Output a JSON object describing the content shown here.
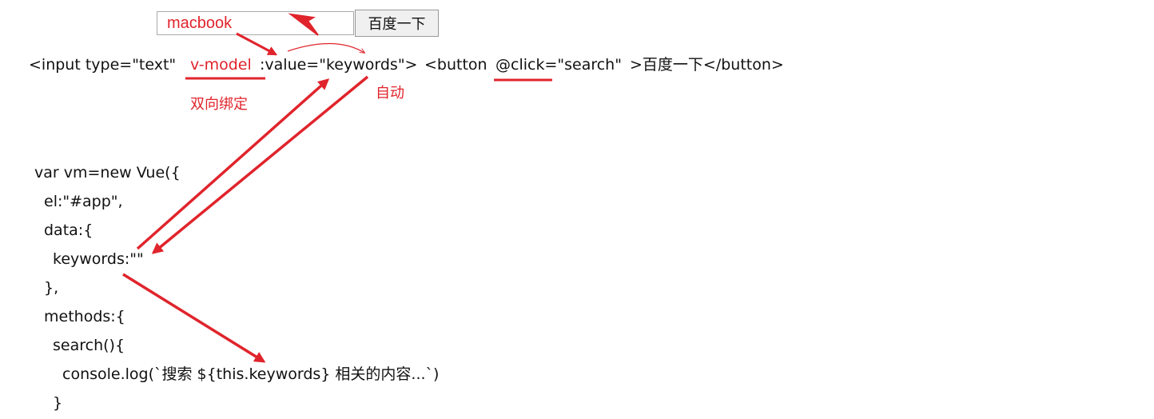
{
  "search": {
    "input_value": "macbook",
    "button_label": "百度一下"
  },
  "template_line": {
    "part1": "<input type=\"text\"",
    "vmodel": "v-model",
    "part2": ":value=\"keywords\">",
    "part3": "<button",
    "click": "@click=\"search\"",
    "part4": ">百度一下</button>"
  },
  "annotations": {
    "two_way_binding": "双向绑定",
    "auto": "自动"
  },
  "code_lines": [
    "var vm=new Vue({",
    "el:\"#app\",",
    "data:{",
    "keywords:\"\"",
    "},",
    "methods:{",
    "search(){",
    "console.log(`搜索 ${this.keywords} 相关的内容...`)",
    "}"
  ],
  "colors": {
    "annotation_red": "#e0242c"
  }
}
